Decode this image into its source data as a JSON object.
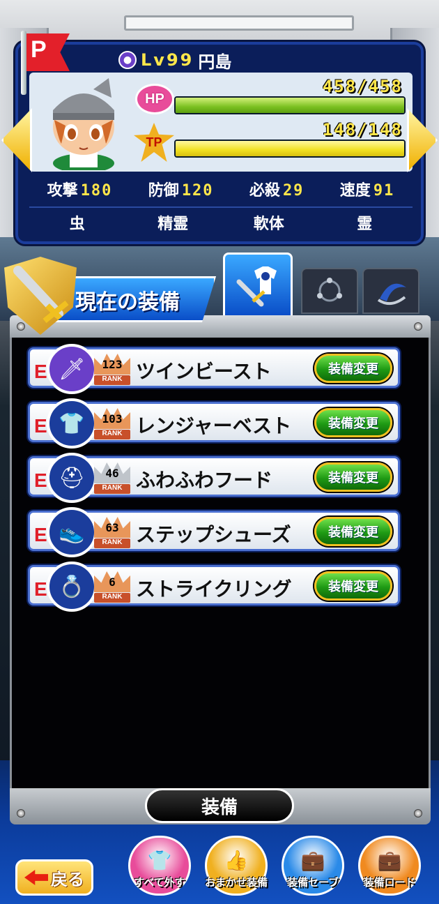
{
  "character": {
    "level_label": "Lv99",
    "name": "円島",
    "hp": "458/458",
    "hp_label": "HP",
    "hp_fraction": 1.0,
    "tp": "148/148",
    "tp_label": "TP",
    "tp_fraction": 1.0,
    "stats": [
      {
        "label": "攻撃",
        "value": "180"
      },
      {
        "label": "防御",
        "value": "120"
      },
      {
        "label": "必殺",
        "value": "29"
      },
      {
        "label": "速度",
        "value": "91"
      }
    ],
    "types": [
      "虫",
      "精霊",
      "軟体",
      "霊"
    ]
  },
  "flag_letter": "P",
  "section_title": "現在の装備",
  "equipment": [
    {
      "grade": "E",
      "rank": "123",
      "rank_word": "RANK",
      "name": "ツインビースト",
      "button": "装備変更",
      "slot_icon": "dagger-icon",
      "slot_color": "#6a3fc8",
      "crown_color": "#e8965a"
    },
    {
      "grade": "E",
      "rank": "103",
      "rank_word": "RANK",
      "name": "レンジャーベスト",
      "button": "装備変更",
      "slot_icon": "shirt-icon",
      "slot_color": "#1b3d9c",
      "crown_color": "#e8965a"
    },
    {
      "grade": "E",
      "rank": "46",
      "rank_word": "RANK",
      "name": "ふわふわフード",
      "button": "装備変更",
      "slot_icon": "helmet-icon",
      "slot_color": "#1b3d9c",
      "crown_color": "#bfc4ca"
    },
    {
      "grade": "E",
      "rank": "63",
      "rank_word": "RANK",
      "name": "ステップシューズ",
      "button": "装備変更",
      "slot_icon": "shoe-icon",
      "slot_color": "#1b3d9c",
      "crown_color": "#e8965a"
    },
    {
      "grade": "E",
      "rank": "6",
      "rank_word": "RANK",
      "name": "ストライクリング",
      "button": "装備変更",
      "slot_icon": "ring-icon",
      "slot_color": "#1b3d9c",
      "crown_color": "#e8965a"
    }
  ],
  "footer_label": "装備",
  "nav": {
    "back": "戻る",
    "buttons": [
      {
        "label": "すべて外す",
        "icon": "unequip-all-icon",
        "color": "#e84c9a"
      },
      {
        "label": "おまかせ装備",
        "icon": "thumbs-up-icon",
        "color": "#f0b020"
      },
      {
        "label": "装備セーブ",
        "icon": "save-icon",
        "color": "#2a8ae8"
      },
      {
        "label": "装備ロード",
        "icon": "load-icon",
        "color": "#f08a20"
      }
    ]
  }
}
